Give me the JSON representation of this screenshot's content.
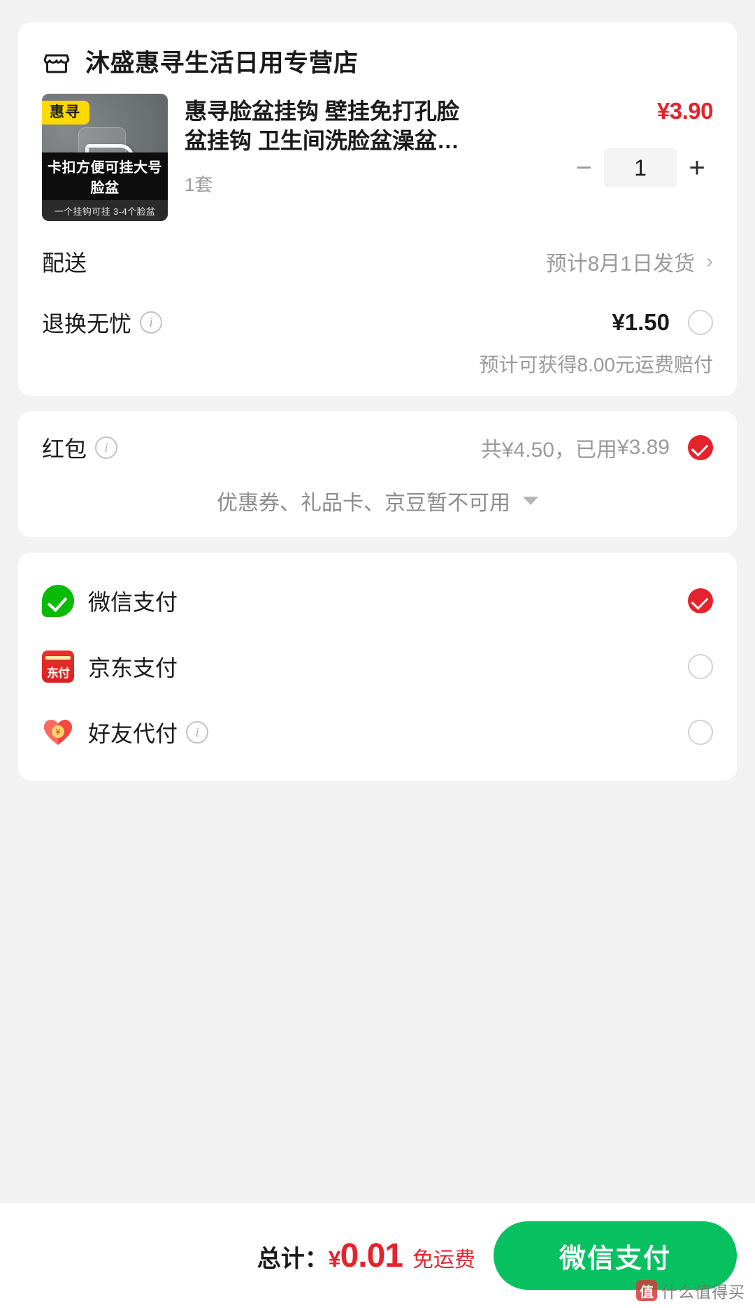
{
  "store": {
    "icon": "shop-icon",
    "name": "沐盛惠寻生活日用专营店"
  },
  "product": {
    "brand_badge": "惠寻",
    "image_caption": "卡扣方便可挂大号脸盆",
    "image_subcaption": "一个挂钩可挂 3-4个脸盆",
    "title": "惠寻脸盆挂钩 壁挂免打孔脸盆挂钩 卫生间洗脸盆澡盆…",
    "spec": "1套",
    "price": "¥3.90",
    "quantity": "1",
    "minus_label": "−",
    "plus_label": "+"
  },
  "delivery": {
    "label": "配送",
    "value": "预计8月1日发货",
    "chevron": "›"
  },
  "return_service": {
    "label": "退换无忧",
    "info_icon": "i",
    "price": "¥1.50",
    "note": "预计可获得8.00元运费赔付",
    "selected": false
  },
  "redpacket": {
    "label": "红包",
    "info_icon": "i",
    "total_text": "共¥4.50，已用",
    "used_amount": "¥3.89",
    "selected": true,
    "coupon_note": "优惠券、礼品卡、京豆暂不可用"
  },
  "payments": [
    {
      "icon": "wechat-pay-icon",
      "label": "微信支付",
      "selected": true,
      "has_info": false
    },
    {
      "icon": "jd-pay-icon",
      "label": "京东支付",
      "selected": false,
      "has_info": false
    },
    {
      "icon": "friend-pay-heart-icon",
      "label": "好友代付",
      "selected": false,
      "has_info": true,
      "info_icon": "i"
    }
  ],
  "bottom": {
    "total_label": "总计：",
    "currency": "¥",
    "total_amount": "0.01",
    "free_shipping": "免运费",
    "pay_button": "微信支付"
  },
  "watermark": {
    "badge": "值",
    "text": "什么值得买"
  },
  "colors": {
    "accent_red": "#e4232d",
    "wechat_green": "#07c160",
    "brand_yellow": "#ffd900",
    "page_bg": "#f2f2f2"
  }
}
